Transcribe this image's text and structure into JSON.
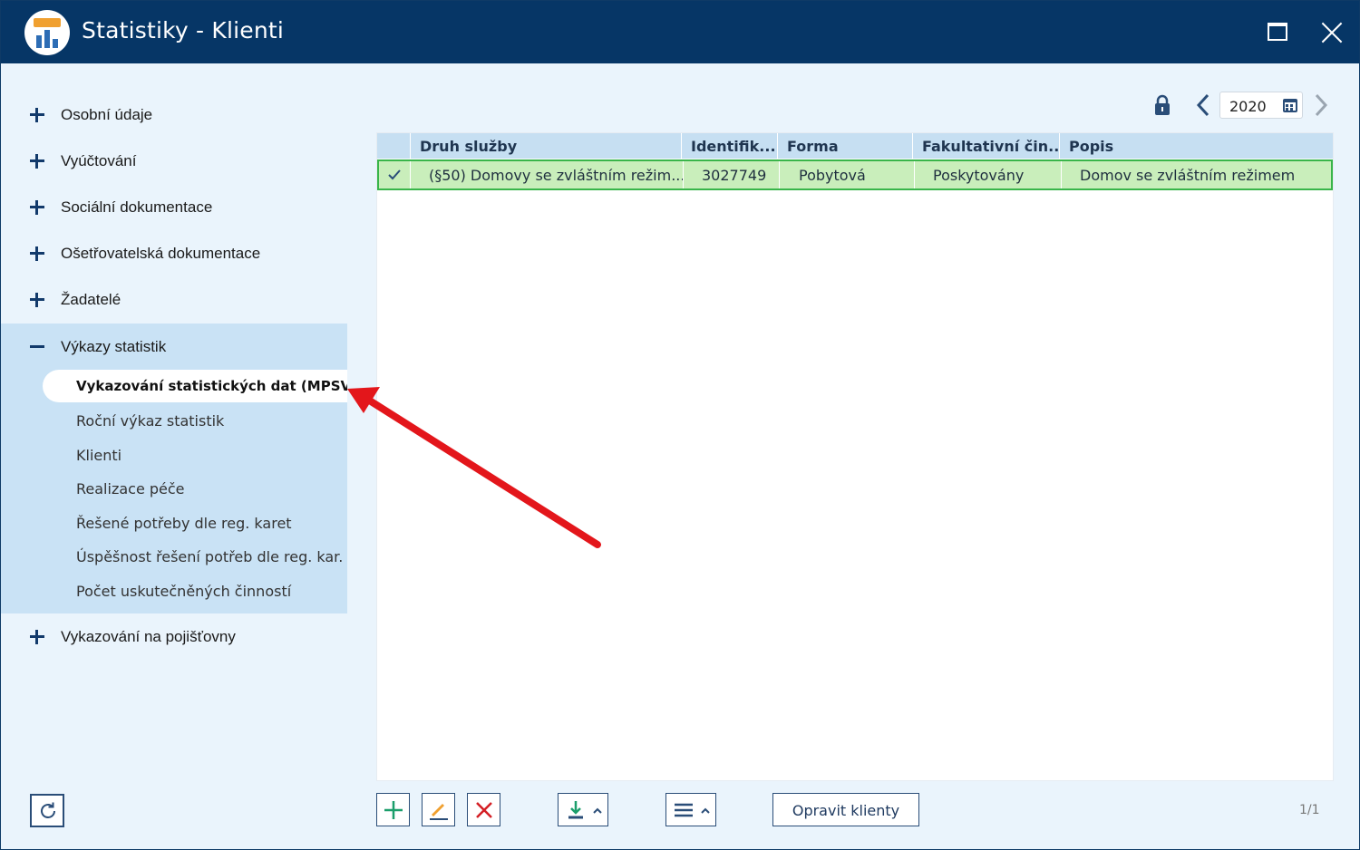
{
  "window": {
    "title": "Statistiky - Klienti"
  },
  "sidebar": {
    "items": [
      {
        "label": "Osobní údaje",
        "symbol": "+"
      },
      {
        "label": "Vyúčtování",
        "symbol": "+"
      },
      {
        "label": "Sociální dokumentace",
        "symbol": "+"
      },
      {
        "label": "Ošetřovatelská dokumentace",
        "symbol": "+"
      },
      {
        "label": "Žadatelé",
        "symbol": "+"
      },
      {
        "label": "Výkazy statistik",
        "symbol": "−"
      },
      {
        "label": "Vykazování na pojišťovny",
        "symbol": "+"
      }
    ],
    "subitems": [
      {
        "label": "Vykazování statistických dat (MPSV)",
        "active": true
      },
      {
        "label": "Roční výkaz statistik"
      },
      {
        "label": "Klienti"
      },
      {
        "label": "Realizace péče"
      },
      {
        "label": "Řešené potřeby dle reg. karet"
      },
      {
        "label": "Úspěšnost řešení potřeb dle reg. kar."
      },
      {
        "label": "Počet uskutečněných činností"
      }
    ]
  },
  "year_selector": {
    "year": "2020"
  },
  "table": {
    "columns": [
      "Druh služby",
      "Identifik...",
      "Forma",
      "Fakultativní čin...",
      "Popis"
    ],
    "rows": [
      {
        "checked": true,
        "cells": [
          "(§50) Domovy se zvláštním režim...",
          "3027749",
          "Pobytová",
          "Poskytovány",
          "Domov se zvláštním režimem"
        ]
      }
    ]
  },
  "toolbar": {
    "fix_clients_label": "Opravit klienty",
    "pager": "1/1"
  },
  "colors": {
    "titlebar": "#063666",
    "sidebar": "#eaf4fc",
    "expanded": "#c9e2f5",
    "selected_row": "#c9eebb",
    "selected_border": "#39b54a",
    "arrow": "#e3161b"
  }
}
